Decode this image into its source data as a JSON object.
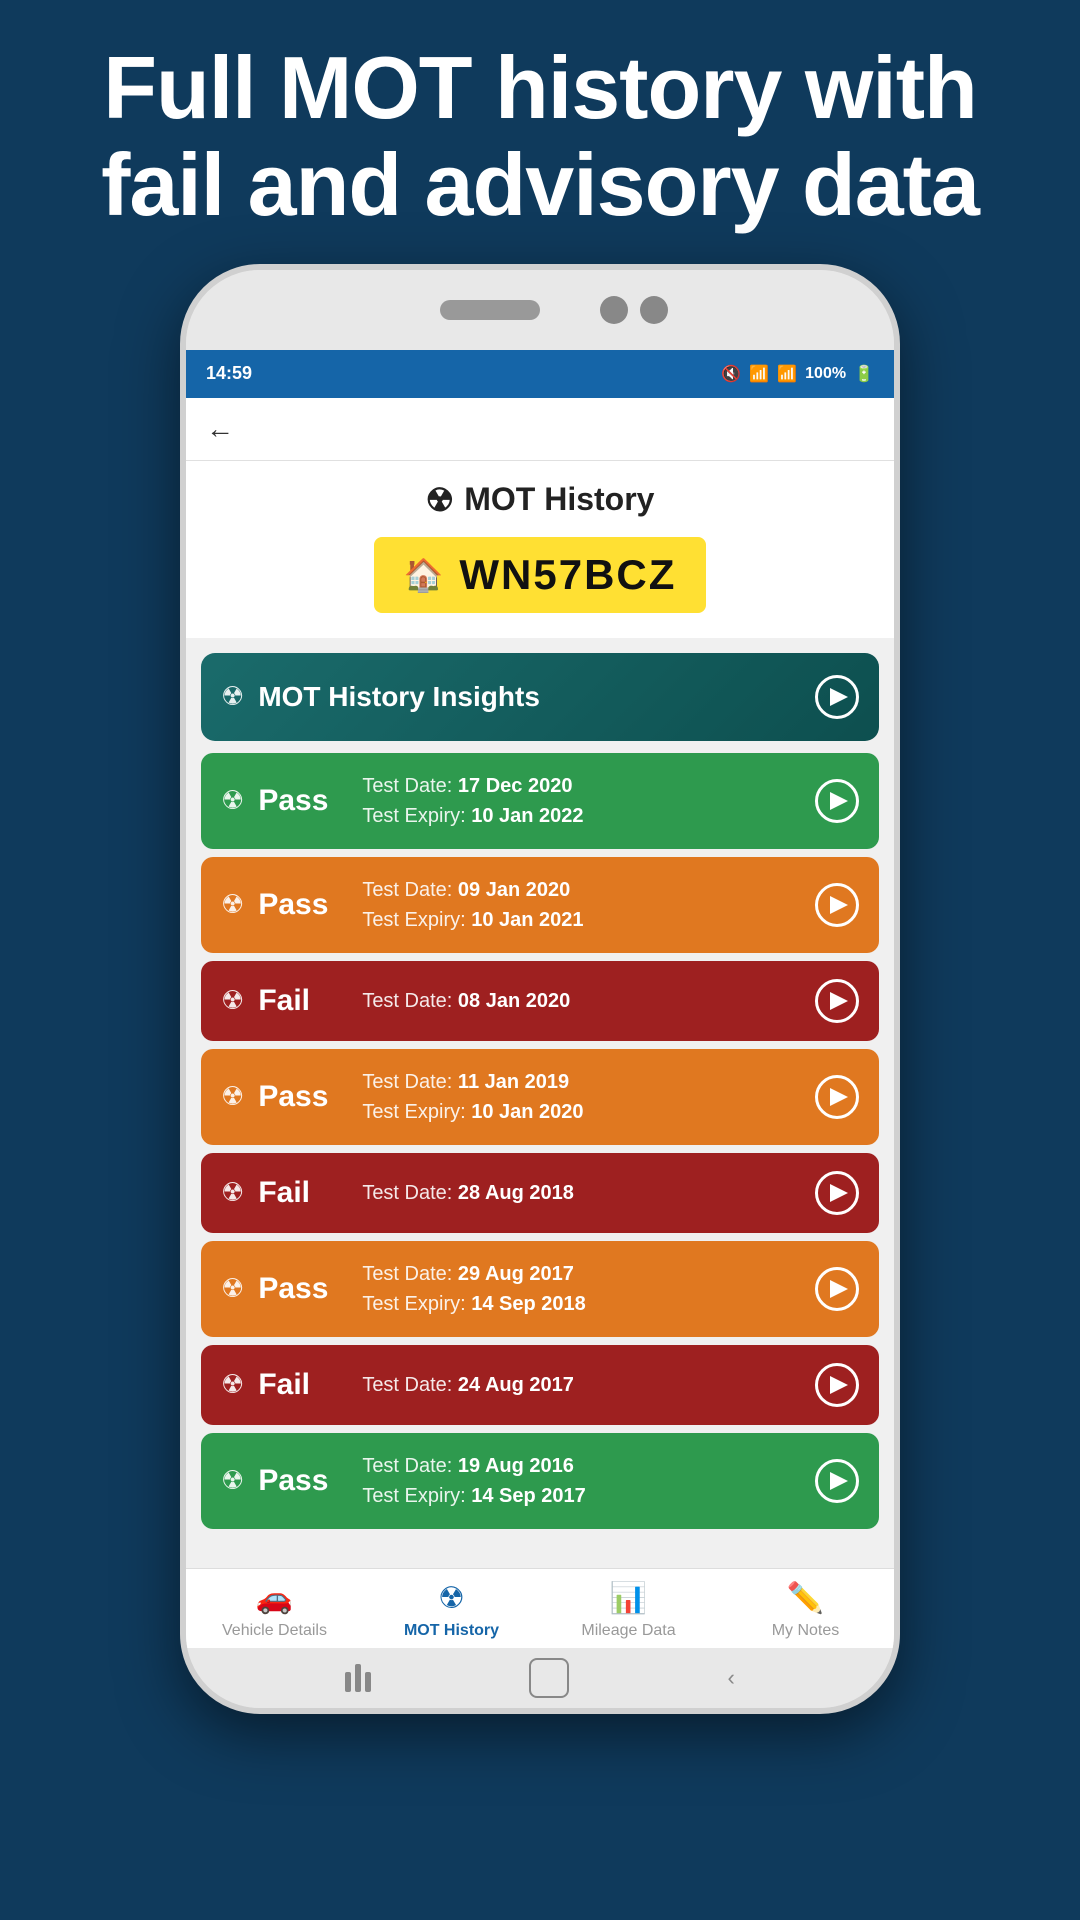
{
  "header": {
    "title": "Full MOT history with fail and advisory data"
  },
  "status_bar": {
    "time": "14:59",
    "battery": "100%"
  },
  "app_header": {
    "back_label": "←"
  },
  "title_section": {
    "mot_icon": "☢",
    "mot_title": "MOT History",
    "plate_icon": "🏠",
    "plate_number": "WN57BCZ"
  },
  "insights": {
    "icon": "☢",
    "label": "MOT History Insights"
  },
  "mot_records": [
    {
      "result": "Pass",
      "color_class": "pass-green",
      "test_date_label": "Test Date:",
      "test_date_value": "17 Dec 2020",
      "expiry_label": "Test Expiry:",
      "expiry_value": "10 Jan 2022",
      "has_expiry": true
    },
    {
      "result": "Pass",
      "color_class": "pass-orange",
      "test_date_label": "Test Date:",
      "test_date_value": "09 Jan 2020",
      "expiry_label": "Test Expiry:",
      "expiry_value": "10 Jan 2021",
      "has_expiry": true
    },
    {
      "result": "Fail",
      "color_class": "fail-red",
      "test_date_label": "Test Date:",
      "test_date_value": "08 Jan 2020",
      "has_expiry": false
    },
    {
      "result": "Pass",
      "color_class": "pass-orange",
      "test_date_label": "Test Date:",
      "test_date_value": "11 Jan 2019",
      "expiry_label": "Test Expiry:",
      "expiry_value": "10 Jan 2020",
      "has_expiry": true
    },
    {
      "result": "Fail",
      "color_class": "fail-red",
      "test_date_label": "Test Date:",
      "test_date_value": "28 Aug 2018",
      "has_expiry": false
    },
    {
      "result": "Pass",
      "color_class": "pass-orange",
      "test_date_label": "Test Date:",
      "test_date_value": "29 Aug 2017",
      "expiry_label": "Test Expiry:",
      "expiry_value": "14 Sep 2018",
      "has_expiry": true
    },
    {
      "result": "Fail",
      "color_class": "fail-red",
      "test_date_label": "Test Date:",
      "test_date_value": "24 Aug 2017",
      "has_expiry": false
    },
    {
      "result": "Pass",
      "color_class": "pass-green",
      "test_date_label": "Test Date:",
      "test_date_value": "19 Aug 2016",
      "expiry_label": "Test Expiry:",
      "expiry_value": "14 Sep 2017",
      "has_expiry": true
    }
  ],
  "bottom_nav": {
    "items": [
      {
        "icon": "🚗",
        "label": "Vehicle Details",
        "active": false
      },
      {
        "icon": "☢",
        "label": "MOT History",
        "active": true
      },
      {
        "icon": "📊",
        "label": "Mileage Data",
        "active": false
      },
      {
        "icon": "✏️",
        "label": "My Notes",
        "active": false
      }
    ]
  }
}
